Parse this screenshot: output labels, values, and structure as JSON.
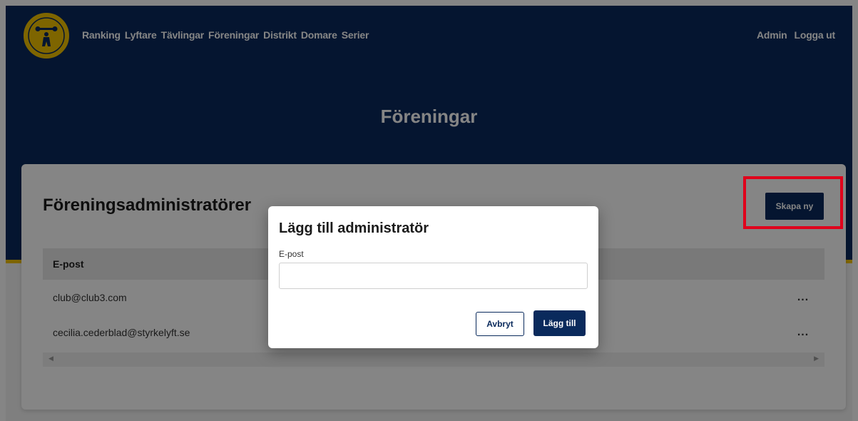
{
  "nav": {
    "links": [
      "Ranking",
      "Lyftare",
      "Tävlingar",
      "Föreningar",
      "Distrikt",
      "Domare",
      "Serier"
    ],
    "right": [
      "Admin",
      "Logga ut"
    ]
  },
  "hero": {
    "title": "Föreningar"
  },
  "card": {
    "title": "Föreningsadministratörer",
    "create_label": "Skapa ny",
    "table": {
      "columns": [
        "E-post"
      ],
      "rows": [
        "club@club3.com",
        "cecilia.cederblad@styrkelyft.se"
      ],
      "row_action": "..."
    }
  },
  "modal": {
    "title": "Lägg till administratör",
    "field_label": "E-post",
    "field_value": "",
    "cancel_label": "Avbryt",
    "add_label": "Lägg till"
  },
  "colors": {
    "primary": "#0a2a5c",
    "accent": "#f2c200",
    "highlight": "#e0001b"
  }
}
